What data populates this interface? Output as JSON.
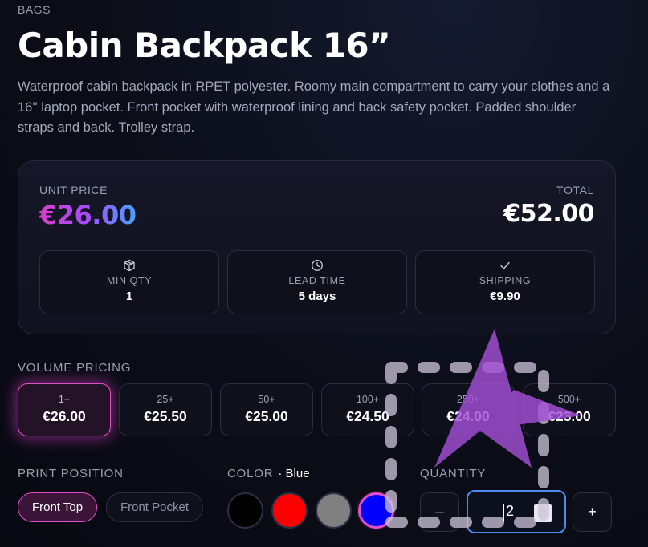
{
  "product": {
    "category": "BAGS",
    "title": "Cabin Backpack 16”",
    "description": "Waterproof cabin backpack in RPET polyester. Roomy main compartment to carry your clothes and a 16'' laptop pocket. Front pocket with waterproof lining and back safety pocket. Padded shoulder straps and back. Trolley strap."
  },
  "pricing": {
    "unit_price_label": "UNIT PRICE",
    "unit_price": "€26.00",
    "total_label": "TOTAL",
    "total": "€52.00",
    "stats": [
      {
        "icon": "box-icon",
        "label": "MIN QTY",
        "value": "1"
      },
      {
        "icon": "clock-icon",
        "label": "LEAD TIME",
        "value": "5 days"
      },
      {
        "icon": "check-icon",
        "label": "SHIPPING",
        "value": "€9.90"
      }
    ]
  },
  "volume": {
    "label": "VOLUME PRICING",
    "active_index": 0,
    "tiers": [
      {
        "qty": "1+",
        "price": "€26.00"
      },
      {
        "qty": "25+",
        "price": "€25.50"
      },
      {
        "qty": "50+",
        "price": "€25.00"
      },
      {
        "qty": "100+",
        "price": "€24.50"
      },
      {
        "qty": "250+",
        "price": "€24.00"
      },
      {
        "qty": "500+",
        "price": "€23.00"
      }
    ]
  },
  "print_position": {
    "label": "PRINT POSITION",
    "options": [
      "Front Top",
      "Front Pocket"
    ],
    "selected": "Front Top"
  },
  "color": {
    "label": "COLOR",
    "selected_prefix": "·",
    "selected_name": "Blue",
    "swatches": [
      {
        "name": "black",
        "hex": "#000000"
      },
      {
        "name": "red",
        "hex": "#ff0000"
      },
      {
        "name": "grey",
        "hex": "#808080"
      },
      {
        "name": "blue",
        "hex": "#0000ff"
      }
    ]
  },
  "quantity": {
    "label": "QUANTITY",
    "value": "2",
    "decrement_label": "–",
    "increment_label": "+"
  },
  "colors": {
    "accent": "#e14fc9",
    "focus": "#4b8cf0",
    "cursor_overlay": "#a34fd6"
  }
}
